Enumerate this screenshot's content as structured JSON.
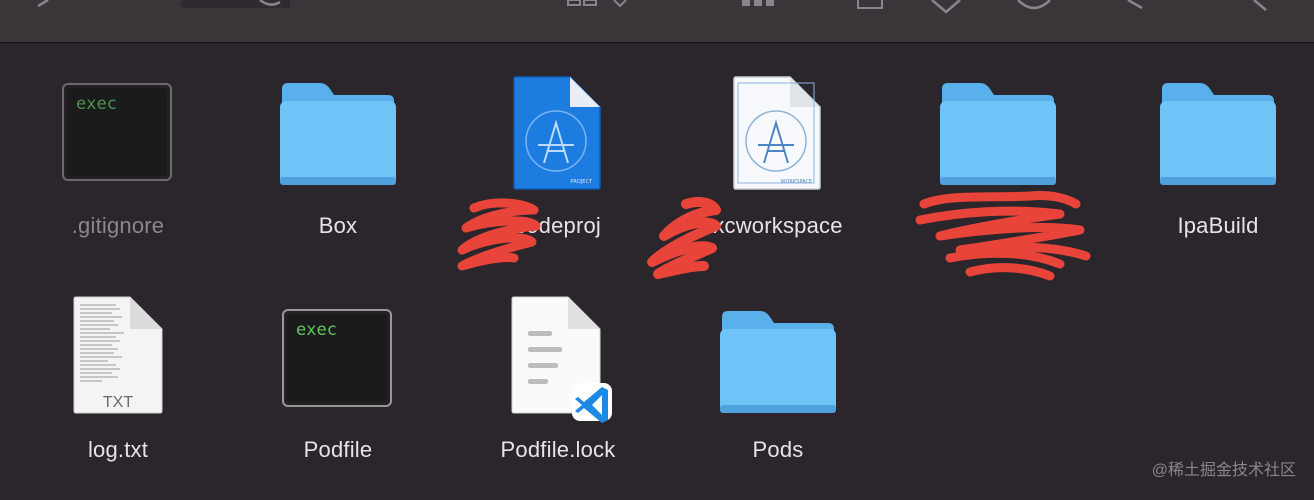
{
  "toolbar": {
    "icons": [
      "back-icon",
      "grid-view-icon",
      "group-icon",
      "share-icon",
      "tag-icon",
      "action-icon",
      "expand-icon",
      "search-icon"
    ]
  },
  "files": [
    {
      "name": ".gitignore",
      "kind": "exec-document",
      "icon_text": "exec",
      "dimmed": true
    },
    {
      "name": "Box",
      "kind": "folder"
    },
    {
      "name": "codeproj",
      "kind": "xcode-project",
      "badge": "PROJECT"
    },
    {
      "name": "xcworkspace",
      "kind": "xcode-workspace",
      "badge": "WORKSPACE"
    },
    {
      "name": "",
      "kind": "folder"
    },
    {
      "name": "IpaBuild",
      "kind": "folder"
    },
    {
      "name": "log.txt",
      "kind": "text-document",
      "badge": "TXT"
    },
    {
      "name": "Podfile",
      "kind": "exec-document",
      "icon_text": "exec"
    },
    {
      "name": "Podfile.lock",
      "kind": "vscode-document"
    },
    {
      "name": "Pods",
      "kind": "folder"
    }
  ],
  "watermark": "@稀土掘金技术社区",
  "colors": {
    "background": "#2b262b",
    "toolbar": "#3a3539",
    "folder": "#6ec3f7",
    "xcode_blue": "#1d7ce0",
    "exec_green": "#5fc55f",
    "scribble_red": "#e8443a"
  }
}
